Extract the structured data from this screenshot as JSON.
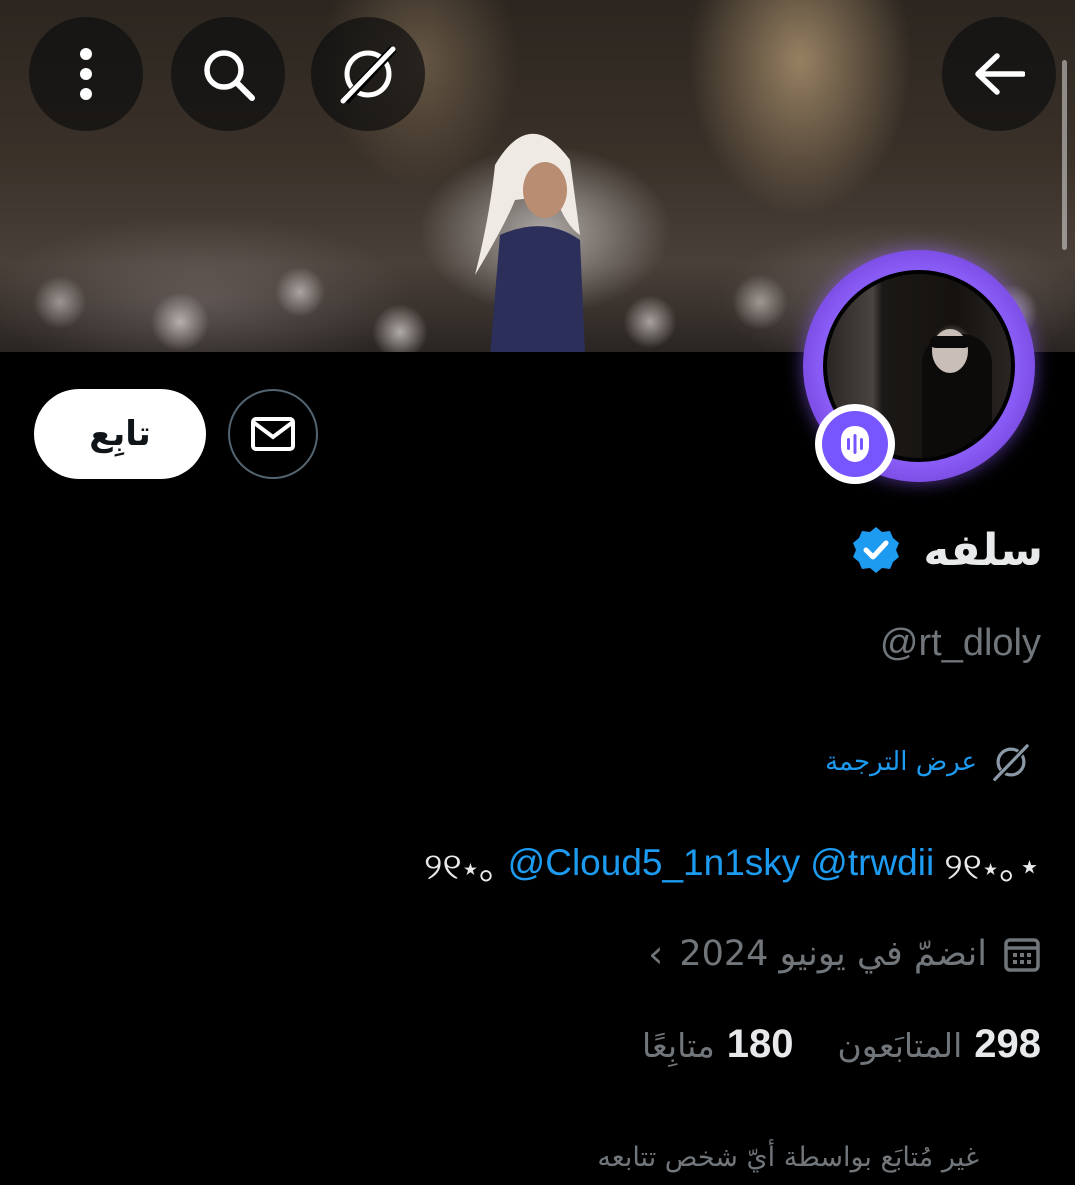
{
  "header": {
    "back_icon": "arrow-left-icon",
    "translate_icon": "grok-icon",
    "search_icon": "search-icon",
    "more_icon": "more-vertical-icon"
  },
  "actions": {
    "follow_label": "تابِع",
    "message_icon": "envelope-icon"
  },
  "profile": {
    "display_name": "سلفه",
    "verified_icon": "verified-badge-icon",
    "handle": "@rt_dloly",
    "translate_label": "عرض الترجمة",
    "bio_deco_left": "୨୧⋆｡",
    "bio_mention_1": "@Cloud5_1n1sky",
    "bio_mention_2": "@trwdii",
    "bio_deco_right": "୨୧⋆｡⋆",
    "joined": "انضمّ في يونيو 2024",
    "followers_count": "298",
    "followers_label": "المتابَعون",
    "following_count": "180",
    "following_label": "متابِعًا",
    "not_followed_note": "غير مُتابَع بواسطة أيّ شخص تتابعه"
  },
  "colors": {
    "accent": "#1d9bf0",
    "muted": "#71767b",
    "spaces_purple": "#7856ff"
  }
}
